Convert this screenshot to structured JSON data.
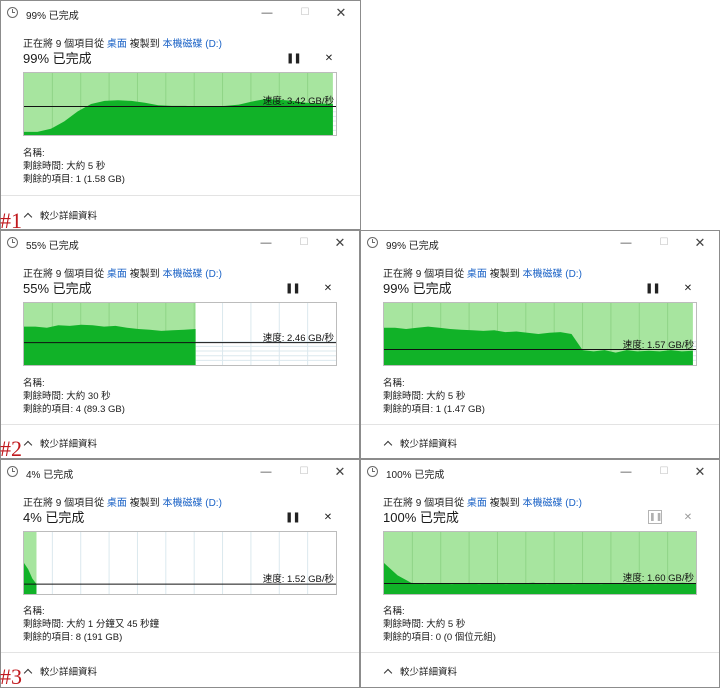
{
  "dialogs": [
    {
      "title": "99% 已完成",
      "copy_prefix": "正在將 9 個項目從",
      "copy_source": "桌面",
      "copy_middle": "複製到",
      "copy_dest": "本機磁碟 (D:)",
      "percent_label": "99% 已完成",
      "progress": 0.99,
      "speed_label": "速度: 3.42 GB/秒",
      "name_label": "名稱:",
      "time_remaining": "剩餘時間: 大約 5 秒",
      "items_remaining": "剩餘的項目: 1 (1.58 GB)",
      "fewer_details": "較少詳細資料",
      "pause_icon": "pause-icon",
      "paused": false,
      "speed_level": 0.46,
      "peak_level": 0.55,
      "throughput": [
        0.05,
        0.05,
        0.1,
        0.22,
        0.38,
        0.5,
        0.55,
        0.56,
        0.55,
        0.52,
        0.48,
        0.47,
        0.47,
        0.46,
        0.46,
        0.47,
        0.49,
        0.54,
        0.58,
        0.57,
        0.55,
        0.52,
        0.51,
        0.5
      ]
    },
    {
      "title": "55% 已完成",
      "copy_prefix": "正在將 9 個項目從",
      "copy_source": "桌面",
      "copy_middle": "複製到",
      "copy_dest": "本機磁碟 (D:)",
      "percent_label": "55% 已完成",
      "progress": 0.55,
      "speed_label": "速度: 2.46 GB/秒",
      "name_label": "名稱:",
      "time_remaining": "剩餘時間: 大約 30 秒",
      "items_remaining": "剩餘的項目: 4 (89.3 GB)",
      "fewer_details": "較少詳細資料",
      "pause_icon": "pause-icon",
      "paused": false,
      "speed_level": 0.36,
      "peak_level": 0.6,
      "throughput": [
        0.62,
        0.62,
        0.6,
        0.64,
        0.63,
        0.65,
        0.64,
        0.62,
        0.63,
        0.6,
        0.58,
        0.57,
        0.55,
        0.56,
        0.57,
        0.58
      ]
    },
    {
      "title": "99% 已完成",
      "copy_prefix": "正在將 9 個項目從",
      "copy_source": "桌面",
      "copy_middle": "複製到",
      "copy_dest": "本機磁碟 (D:)",
      "percent_label": "99% 已完成",
      "progress": 0.99,
      "speed_label": "速度: 1.57 GB/秒",
      "name_label": "名稱:",
      "time_remaining": "剩餘時間: 大約 5 秒",
      "items_remaining": "剩餘的項目: 1 (1.47 GB)",
      "fewer_details": "較少詳細資料",
      "pause_icon": "pause-icon",
      "paused": false,
      "speed_level": 0.25,
      "peak_level": 0.6,
      "throughput": [
        0.6,
        0.6,
        0.58,
        0.6,
        0.62,
        0.6,
        0.58,
        0.57,
        0.56,
        0.55,
        0.56,
        0.53,
        0.54,
        0.52,
        0.5,
        0.52,
        0.53,
        0.5,
        0.24,
        0.22,
        0.24,
        0.2,
        0.24,
        0.22,
        0.23,
        0.22,
        0.24,
        0.22,
        0.23
      ]
    },
    {
      "title": "4% 已完成",
      "copy_prefix": "正在將 9 個項目從",
      "copy_source": "桌面",
      "copy_middle": "複製到",
      "copy_dest": "本機磁碟 (D:)",
      "percent_label": "4% 已完成",
      "progress": 0.04,
      "speed_label": "速度: 1.52 GB/秒",
      "name_label": "名稱:",
      "time_remaining": "剩餘時間: 大約 1 分鐘又 45 秒鐘",
      "items_remaining": "剩餘的項目: 8 (191 GB)",
      "fewer_details": "較少詳細資料",
      "pause_icon": "pause-icon",
      "paused": false,
      "speed_level": 0.16,
      "peak_level": 0.5,
      "throughput": [
        0.5,
        0.4,
        0.25,
        0.16
      ]
    },
    {
      "title": "100% 已完成",
      "copy_prefix": "正在將 9 個項目從",
      "copy_source": "桌面",
      "copy_middle": "複製到",
      "copy_dest": "本機磁碟 (D:)",
      "percent_label": "100% 已完成",
      "progress": 1.0,
      "speed_label": "速度: 1.60 GB/秒",
      "name_label": "名稱:",
      "time_remaining": "剩餘時間: 大約 5 秒",
      "items_remaining": "剩餘的項目: 0 (0 個位元組)",
      "fewer_details": "較少詳細資料",
      "pause_icon": "pause-icon",
      "paused": true,
      "speed_level": 0.17,
      "peak_level": 0.5,
      "throughput": [
        0.5,
        0.3,
        0.18,
        0.16,
        0.17,
        0.16,
        0.17,
        0.16,
        0.17,
        0.16,
        0.17,
        0.18,
        0.16,
        0.17,
        0.16,
        0.17,
        0.16,
        0.17,
        0.16,
        0.17,
        0.16,
        0.17,
        0.18,
        0.17
      ]
    }
  ],
  "annotations": [
    "#1",
    "#2",
    "#3"
  ],
  "window_controls": {
    "minimize": "—",
    "maximize": "☐",
    "close": "✕",
    "stop": "✕"
  },
  "colors": {
    "graph_fill": "#11b228",
    "graph_remaining_bg": "#a7e59f",
    "link": "#1a62c6",
    "annotation": "#c0191d"
  }
}
